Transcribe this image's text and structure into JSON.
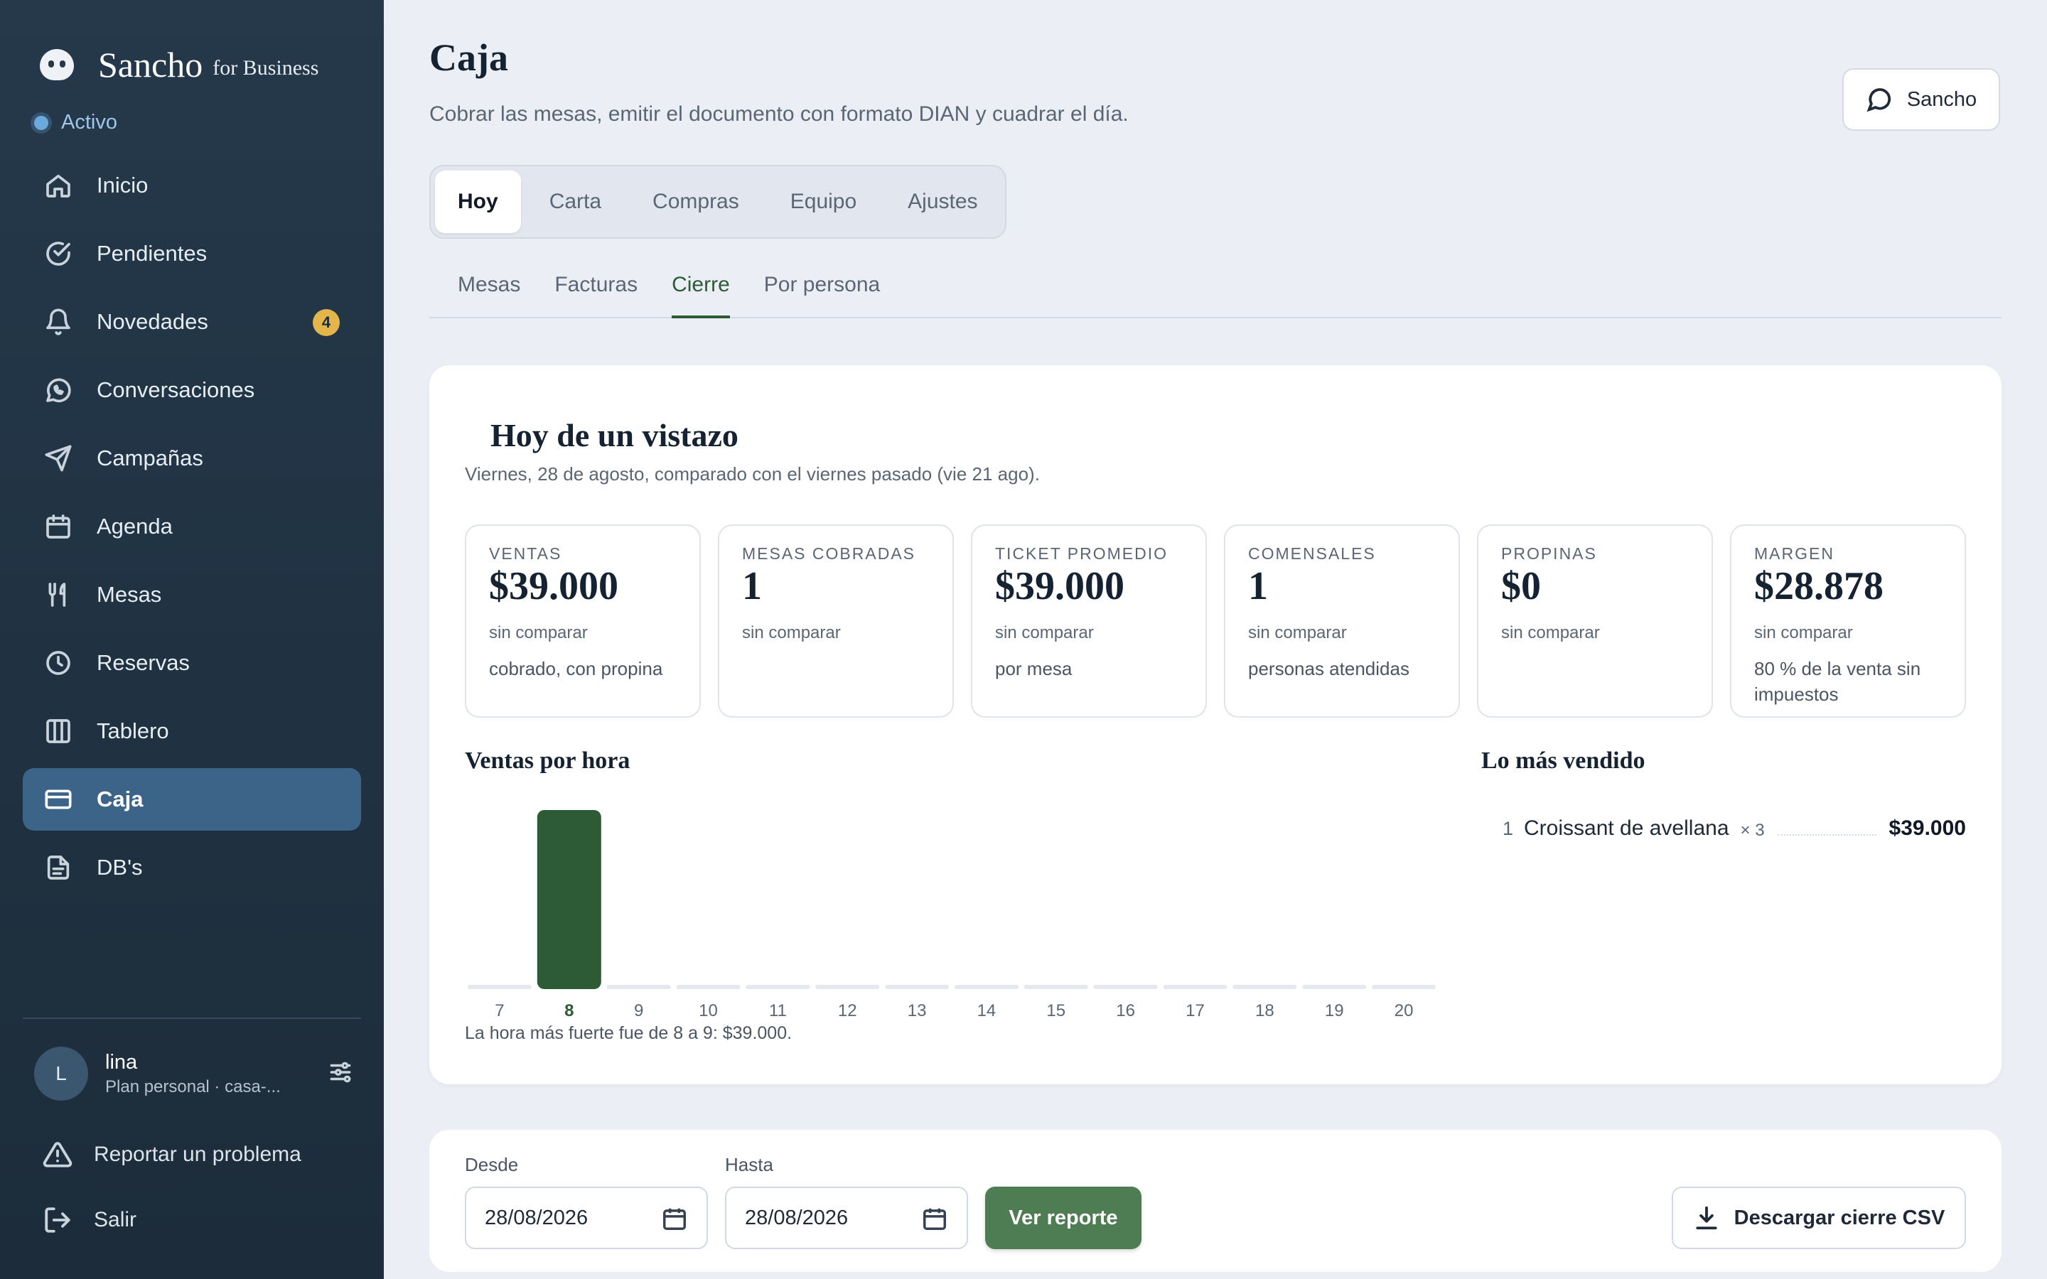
{
  "brand": {
    "name": "Sancho",
    "suffix": "for Business"
  },
  "status": "Activo",
  "sidebar": {
    "items": [
      {
        "label": "Inicio",
        "icon": "home-icon"
      },
      {
        "label": "Pendientes",
        "icon": "check-circle-icon"
      },
      {
        "label": "Novedades",
        "icon": "bell-icon",
        "badge": "4"
      },
      {
        "label": "Conversaciones",
        "icon": "whatsapp-icon"
      },
      {
        "label": "Campañas",
        "icon": "send-icon"
      },
      {
        "label": "Agenda",
        "icon": "calendar-icon"
      },
      {
        "label": "Mesas",
        "icon": "utensils-icon"
      },
      {
        "label": "Reservas",
        "icon": "clock-icon"
      },
      {
        "label": "Tablero",
        "icon": "columns-icon"
      },
      {
        "label": "Caja",
        "icon": "credit-card-icon",
        "active": true
      },
      {
        "label": "DB's",
        "icon": "document-icon"
      }
    ]
  },
  "user": {
    "initial": "L",
    "name": "lina",
    "plan": "Plan personal · casa-..."
  },
  "footer_links": {
    "report": "Reportar un problema",
    "logout": "Salir"
  },
  "header": {
    "title": "Caja",
    "subtitle": "Cobrar las mesas, emitir el documento con formato DIAN y cuadrar el día.",
    "assistant_button": "Sancho"
  },
  "tabs": [
    "Hoy",
    "Carta",
    "Compras",
    "Equipo",
    "Ajustes"
  ],
  "active_tab": "Hoy",
  "subtabs": [
    "Mesas",
    "Facturas",
    "Cierre",
    "Por persona"
  ],
  "active_subtab": "Cierre",
  "overview": {
    "title": "Hoy de un vistazo",
    "subtitle": "Viernes, 28 de agosto, comparado con el viernes pasado (vie 21 ago).",
    "kpis": [
      {
        "label": "VENTAS",
        "value": "$39.000",
        "compare": "sin comparar",
        "note": "cobrado, con propina"
      },
      {
        "label": "MESAS COBRADAS",
        "value": "1",
        "compare": "sin comparar",
        "note": ""
      },
      {
        "label": "TICKET PROMEDIO",
        "value": "$39.000",
        "compare": "sin comparar",
        "note": "por mesa"
      },
      {
        "label": "COMENSALES",
        "value": "1",
        "compare": "sin comparar",
        "note": "personas atendidas"
      },
      {
        "label": "PROPINAS",
        "value": "$0",
        "compare": "sin comparar",
        "note": ""
      },
      {
        "label": "MARGEN",
        "value": "$28.878",
        "compare": "sin comparar",
        "note": "80 % de la venta sin impuestos"
      }
    ]
  },
  "chart_data": {
    "type": "bar",
    "title": "Ventas por hora",
    "categories": [
      "7",
      "8",
      "9",
      "10",
      "11",
      "12",
      "13",
      "14",
      "15",
      "16",
      "17",
      "18",
      "19",
      "20"
    ],
    "values": [
      0,
      39000,
      0,
      0,
      0,
      0,
      0,
      0,
      0,
      0,
      0,
      0,
      0,
      0
    ],
    "highlight": "8",
    "bar_color": "#2d5b35",
    "empty_color": "#e5e8ee",
    "ylim": [
      0,
      39000
    ],
    "note": "La hora más fuerte fue de 8 a 9: $39.000."
  },
  "top_sellers": {
    "title": "Lo más vendido",
    "items": [
      {
        "rank": "1",
        "name": "Croissant de avellana",
        "qty": "× 3",
        "amount": "$39.000"
      }
    ]
  },
  "report": {
    "from_label": "Desde",
    "from_value": "28/08/2026",
    "to_label": "Hasta",
    "to_value": "28/08/2026",
    "view_button": "Ver reporte",
    "csv_button": "Descargar cierre CSV"
  }
}
